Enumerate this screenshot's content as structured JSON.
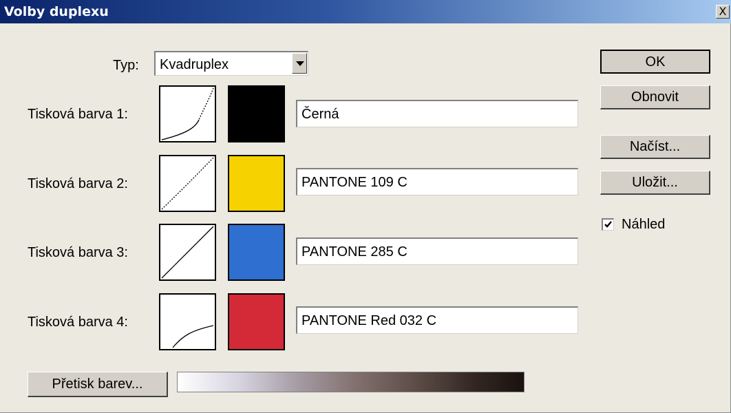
{
  "window": {
    "title": "Volby duplexu",
    "close_label": "X"
  },
  "type_field": {
    "label": "Typ:",
    "selected": "Kvadruplex"
  },
  "inks": [
    {
      "label": "Tisková barva 1:",
      "name": "Černá",
      "color": "#000000"
    },
    {
      "label": "Tisková barva 2:",
      "name": "PANTONE 109 C",
      "color": "#f5d200"
    },
    {
      "label": "Tisková barva 3:",
      "name": "PANTONE 285 C",
      "color": "#2f6fd0"
    },
    {
      "label": "Tisková barva 4:",
      "name": "PANTONE Red 032 C",
      "color": "#d42a38"
    }
  ],
  "buttons": {
    "ok": "OK",
    "reset": "Obnovit",
    "load": "Načíst...",
    "save": "Uložit..."
  },
  "preview": {
    "label": "Náhled",
    "checked": true
  },
  "overprint_label": "Přetisk barev...",
  "colors": {
    "dialog_bg": "#ece9e0",
    "title_start": "#0a246a",
    "title_end": "#a6caf0"
  }
}
